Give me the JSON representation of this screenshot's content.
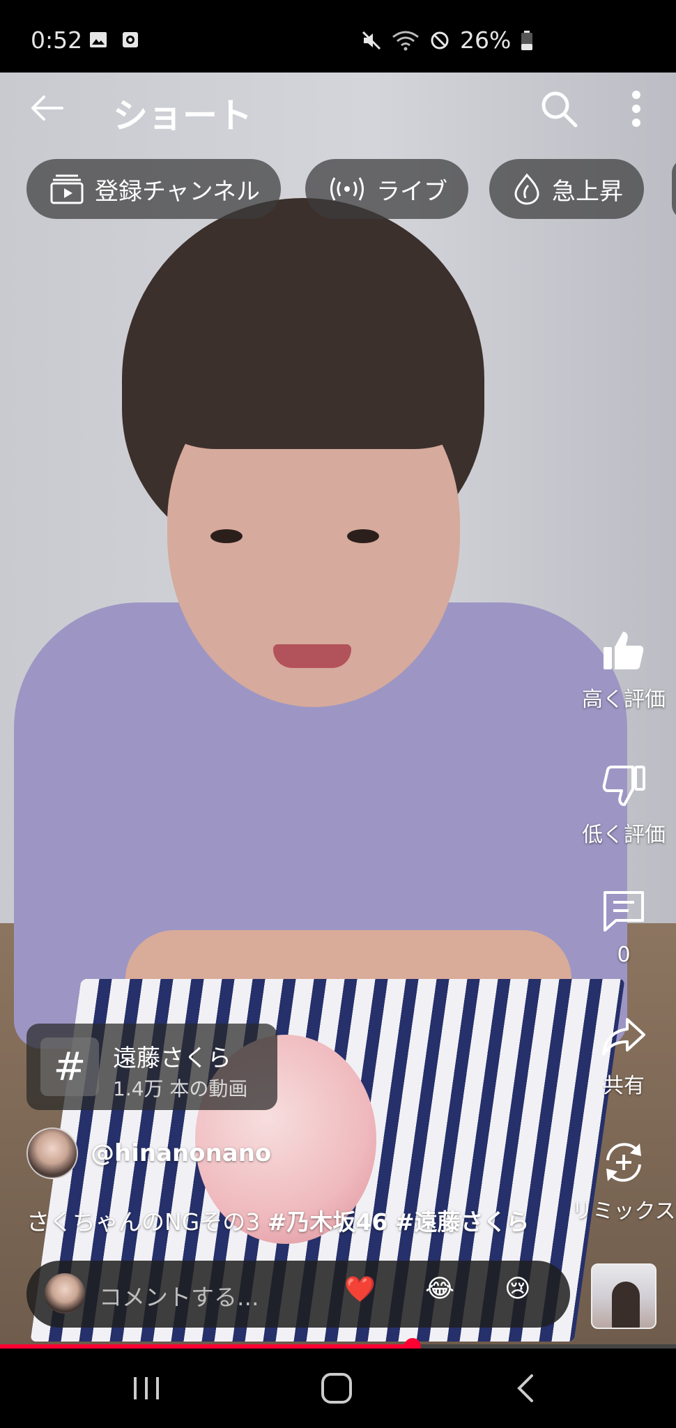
{
  "status_bar": {
    "time": "0:52",
    "battery": "26%",
    "icons": [
      "image-icon",
      "screen-record-icon",
      "mute-icon",
      "wifi-icon",
      "dnd-icon",
      "battery-icon"
    ]
  },
  "top_bar": {
    "title": "ショート",
    "icons": [
      "back-arrow-icon",
      "search-icon",
      "more-vert-icon"
    ]
  },
  "chips": [
    {
      "label": "登録チャンネル",
      "icon": "subscriptions-icon"
    },
    {
      "label": "ライブ",
      "icon": "live-icon"
    },
    {
      "label": "急上昇",
      "icon": "trending-icon"
    }
  ],
  "actions": {
    "like": {
      "label": "高く評価",
      "icon": "thumbs-up-icon"
    },
    "dislike": {
      "label": "低く評価",
      "icon": "thumbs-down-icon"
    },
    "comments": {
      "label": "0",
      "icon": "comment-icon"
    },
    "share": {
      "label": "共有",
      "icon": "share-icon"
    },
    "remix": {
      "label": "リミックス",
      "icon": "remix-icon"
    }
  },
  "hashtag": {
    "symbol": "#",
    "name": "遠藤さくら",
    "count": "1.4万 本の動画"
  },
  "channel": {
    "handle": "@hinanonano"
  },
  "caption": {
    "text": "さくちゃんのNGその3 ",
    "tag1": "#乃木坂46",
    "tag2": "#遠藤さくら"
  },
  "comment_bar": {
    "placeholder": "コメントする...",
    "emojis": [
      "❤️",
      "😂",
      "😢"
    ]
  },
  "progress": {
    "fraction": 0.61
  },
  "colors": {
    "accent": "#ff0033",
    "chip_bg": "#3c3c3c"
  }
}
